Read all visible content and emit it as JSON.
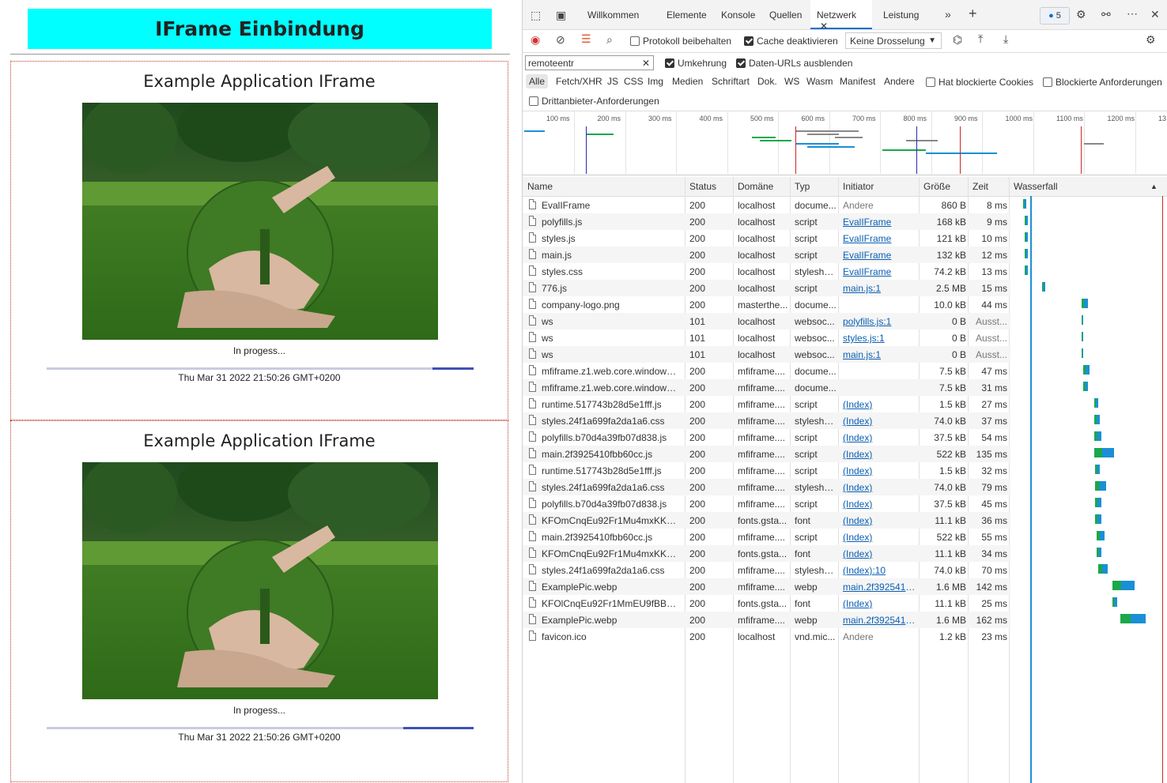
{
  "page": {
    "header_title": "IFrame Einbindung",
    "iframes": [
      {
        "title": "Example Application IFrame",
        "status": "In progess...",
        "date": "Thu Mar 31 2022 21:50:26 GMT+0200",
        "progress": 0.1
      },
      {
        "title": "Example Application IFrame",
        "status": "In progess...",
        "date": "Thu Mar 31 2022 21:50:26 GMT+0200",
        "progress": 0.17
      }
    ]
  },
  "devtools": {
    "tabs": [
      {
        "label": "Willkommen"
      },
      {
        "label": "Elemente"
      },
      {
        "label": "Konsole"
      },
      {
        "label": "Quellen"
      },
      {
        "label": "Netzwerk",
        "active": true
      },
      {
        "label": "Leistung"
      }
    ],
    "issues_count": "5",
    "toolbar": {
      "preserve_log": "Protokoll beibehalten",
      "disable_cache": "Cache deaktivieren",
      "throttling": "Keine Drosselung"
    },
    "filter": {
      "value": "remoteentr",
      "invert": "Umkehrung",
      "hide_data_urls": "Daten-URLs ausblenden",
      "types": [
        "Alle",
        "Fetch/XHR",
        "JS",
        "CSS",
        "Img",
        "Medien",
        "Schriftart",
        "Dok.",
        "WS",
        "Wasm",
        "Manifest",
        "Andere"
      ],
      "blocked_cookies": "Hat blockierte Cookies",
      "blocked_requests": "Blockierte Anforderungen",
      "third_party": "Drittanbieter-Anforderungen"
    },
    "timeline_ticks": [
      "100 ms",
      "200 ms",
      "300 ms",
      "400 ms",
      "500 ms",
      "600 ms",
      "700 ms",
      "800 ms",
      "900 ms",
      "1000 ms",
      "1100 ms",
      "1200 ms",
      "13"
    ],
    "columns": {
      "name": "Name",
      "status": "Status",
      "domain": "Domäne",
      "type": "Typ",
      "initiator": "Initiator",
      "size": "Größe",
      "time": "Zeit",
      "waterfall": "Wasserfall"
    },
    "rows": [
      {
        "name": "EvalIFrame",
        "status": "200",
        "domain": "localhost",
        "type": "docume...",
        "initiator": "Andere",
        "initiator_link": false,
        "size": "860 B",
        "time": "8 ms",
        "wf_start": 0.05,
        "wf_len": 0.02
      },
      {
        "name": "polyfills.js",
        "status": "200",
        "domain": "localhost",
        "type": "script",
        "initiator": "EvalIFrame",
        "initiator_link": true,
        "size": "168 kB",
        "time": "9 ms",
        "wf_start": 0.06,
        "wf_len": 0.02
      },
      {
        "name": "styles.js",
        "status": "200",
        "domain": "localhost",
        "type": "script",
        "initiator": "EvalIFrame",
        "initiator_link": true,
        "size": "121 kB",
        "time": "10 ms",
        "wf_start": 0.06,
        "wf_len": 0.02
      },
      {
        "name": "main.js",
        "status": "200",
        "domain": "localhost",
        "type": "script",
        "initiator": "EvalIFrame",
        "initiator_link": true,
        "size": "132 kB",
        "time": "12 ms",
        "wf_start": 0.06,
        "wf_len": 0.02
      },
      {
        "name": "styles.css",
        "status": "200",
        "domain": "localhost",
        "type": "styleshe...",
        "initiator": "EvalIFrame",
        "initiator_link": true,
        "size": "74.2 kB",
        "time": "13 ms",
        "wf_start": 0.06,
        "wf_len": 0.02
      },
      {
        "name": "776.js",
        "status": "200",
        "domain": "localhost",
        "type": "script",
        "initiator": "main.js:1",
        "initiator_link": true,
        "size": "2.5 MB",
        "time": "15 ms",
        "wf_start": 0.17,
        "wf_len": 0.02
      },
      {
        "name": "company-logo.png",
        "status": "200",
        "domain": "masterthe...",
        "type": "docume...",
        "initiator": "",
        "initiator_link": false,
        "size": "10.0 kB",
        "time": "44 ms",
        "wf_start": 0.42,
        "wf_len": 0.04
      },
      {
        "name": "ws",
        "status": "101",
        "domain": "localhost",
        "type": "websoc...",
        "initiator": "polyfills.js:1",
        "initiator_link": true,
        "size": "0 B",
        "time": "Ausst...",
        "wf_start": 0.42,
        "wf_len": 0.005
      },
      {
        "name": "ws",
        "status": "101",
        "domain": "localhost",
        "type": "websoc...",
        "initiator": "styles.js:1",
        "initiator_link": true,
        "size": "0 B",
        "time": "Ausst...",
        "wf_start": 0.42,
        "wf_len": 0.005
      },
      {
        "name": "ws",
        "status": "101",
        "domain": "localhost",
        "type": "websoc...",
        "initiator": "main.js:1",
        "initiator_link": true,
        "size": "0 B",
        "time": "Ausst...",
        "wf_start": 0.42,
        "wf_len": 0.005
      },
      {
        "name": "mfiframe.z1.web.core.windows....",
        "status": "200",
        "domain": "mfiframe....",
        "type": "docume...",
        "initiator": "",
        "initiator_link": false,
        "size": "7.5 kB",
        "time": "47 ms",
        "wf_start": 0.43,
        "wf_len": 0.04
      },
      {
        "name": "mfiframe.z1.web.core.windows....",
        "status": "200",
        "domain": "mfiframe....",
        "type": "docume...",
        "initiator": "",
        "initiator_link": false,
        "size": "7.5 kB",
        "time": "31 ms",
        "wf_start": 0.43,
        "wf_len": 0.03
      },
      {
        "name": "runtime.517743b28d5e1fff.js",
        "status": "200",
        "domain": "mfiframe....",
        "type": "script",
        "initiator": "(Index)",
        "initiator_link": true,
        "size": "1.5 kB",
        "time": "27 ms",
        "wf_start": 0.5,
        "wf_len": 0.03
      },
      {
        "name": "styles.24f1a699fa2da1a6.css",
        "status": "200",
        "domain": "mfiframe....",
        "type": "styleshe...",
        "initiator": "(Index)",
        "initiator_link": true,
        "size": "74.0 kB",
        "time": "37 ms",
        "wf_start": 0.5,
        "wf_len": 0.04
      },
      {
        "name": "polyfills.b70d4a39fb07d838.js",
        "status": "200",
        "domain": "mfiframe....",
        "type": "script",
        "initiator": "(Index)",
        "initiator_link": true,
        "size": "37.5 kB",
        "time": "54 ms",
        "wf_start": 0.5,
        "wf_len": 0.05
      },
      {
        "name": "main.2f3925410fbb60cc.js",
        "status": "200",
        "domain": "mfiframe....",
        "type": "script",
        "initiator": "(Index)",
        "initiator_link": true,
        "size": "522 kB",
        "time": "135 ms",
        "wf_start": 0.5,
        "wf_len": 0.13
      },
      {
        "name": "runtime.517743b28d5e1fff.js",
        "status": "200",
        "domain": "mfiframe....",
        "type": "script",
        "initiator": "(Index)",
        "initiator_link": true,
        "size": "1.5 kB",
        "time": "32 ms",
        "wf_start": 0.51,
        "wf_len": 0.03
      },
      {
        "name": "styles.24f1a699fa2da1a6.css",
        "status": "200",
        "domain": "mfiframe....",
        "type": "styleshe...",
        "initiator": "(Index)",
        "initiator_link": true,
        "size": "74.0 kB",
        "time": "79 ms",
        "wf_start": 0.51,
        "wf_len": 0.07
      },
      {
        "name": "polyfills.b70d4a39fb07d838.js",
        "status": "200",
        "domain": "mfiframe....",
        "type": "script",
        "initiator": "(Index)",
        "initiator_link": true,
        "size": "37.5 kB",
        "time": "45 ms",
        "wf_start": 0.51,
        "wf_len": 0.04
      },
      {
        "name": "KFOmCnqEu92Fr1Mu4mxKKTU...",
        "status": "200",
        "domain": "fonts.gsta...",
        "type": "font",
        "initiator": "(Index)",
        "initiator_link": true,
        "size": "11.1 kB",
        "time": "36 ms",
        "wf_start": 0.51,
        "wf_len": 0.04
      },
      {
        "name": "main.2f3925410fbb60cc.js",
        "status": "200",
        "domain": "mfiframe....",
        "type": "script",
        "initiator": "(Index)",
        "initiator_link": true,
        "size": "522 kB",
        "time": "55 ms",
        "wf_start": 0.52,
        "wf_len": 0.05
      },
      {
        "name": "KFOmCnqEu92Fr1Mu4mxKKTU...",
        "status": "200",
        "domain": "fonts.gsta...",
        "type": "font",
        "initiator": "(Index)",
        "initiator_link": true,
        "size": "11.1 kB",
        "time": "34 ms",
        "wf_start": 0.52,
        "wf_len": 0.03
      },
      {
        "name": "styles.24f1a699fa2da1a6.css",
        "status": "200",
        "domain": "mfiframe....",
        "type": "styleshe...",
        "initiator": "(Index):10",
        "initiator_link": true,
        "size": "74.0 kB",
        "time": "70 ms",
        "wf_start": 0.53,
        "wf_len": 0.06
      },
      {
        "name": "ExamplePic.webp",
        "status": "200",
        "domain": "mfiframe....",
        "type": "webp",
        "initiator": "main.2f3925410...",
        "initiator_link": true,
        "size": "1.6 MB",
        "time": "142 ms",
        "wf_start": 0.62,
        "wf_len": 0.14
      },
      {
        "name": "KFOlCnqEu92Fr1MmEU9fBBc4A...",
        "status": "200",
        "domain": "fonts.gsta...",
        "type": "font",
        "initiator": "(Index)",
        "initiator_link": true,
        "size": "11.1 kB",
        "time": "25 ms",
        "wf_start": 0.62,
        "wf_len": 0.03
      },
      {
        "name": "ExamplePic.webp",
        "status": "200",
        "domain": "mfiframe....",
        "type": "webp",
        "initiator": "main.2f3925410...",
        "initiator_link": true,
        "size": "1.6 MB",
        "time": "162 ms",
        "wf_start": 0.67,
        "wf_len": 0.16
      },
      {
        "name": "favicon.ico",
        "status": "200",
        "domain": "localhost",
        "type": "vnd.mic...",
        "initiator": "Andere",
        "initiator_link": false,
        "size": "1.2 kB",
        "time": "23 ms",
        "wf_start": 0.98,
        "wf_len": 0.02
      }
    ],
    "colors": {
      "accent": "#0b6fd1",
      "green": "#1aa84a",
      "blue": "#1a8fd6",
      "red": "#c62828",
      "header_cyan": "#00ffff"
    }
  }
}
